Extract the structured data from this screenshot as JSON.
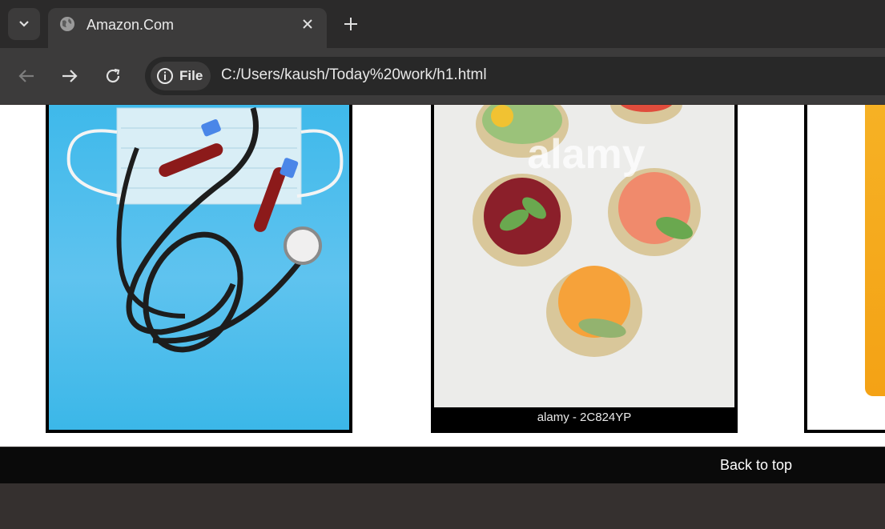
{
  "browser": {
    "tab": {
      "title": "Amazon.Com",
      "favicon": "globe-icon"
    },
    "address_bar": {
      "chip_label": "File",
      "url": "C:/Users/kaush/Today%20work/h1.html"
    }
  },
  "gallery": {
    "images": [
      {
        "alt": "Stethoscope, face mask and blood sample tubes on a blue background"
      },
      {
        "alt": "Rice cakes topped with cucumber, tomato, cherries and apricot slices",
        "caption": "alamy - 2C824YP",
        "watermark": "alamy"
      },
      {
        "alt": "Partially visible orange product image"
      }
    ]
  },
  "footer": {
    "back_to_top": "Back to top"
  },
  "colors": {
    "tab_bar": "#2b2a2a",
    "toolbar": "#3c3b3b",
    "footer": "#0a0a0a",
    "medical_blue": "#3cb8ea"
  }
}
